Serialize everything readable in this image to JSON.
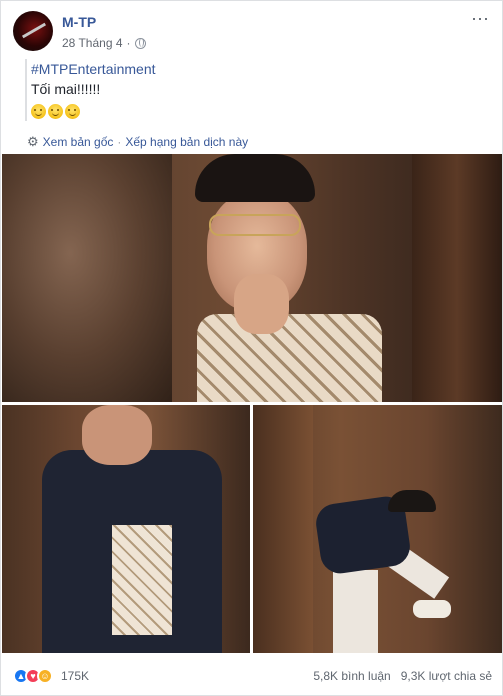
{
  "post": {
    "author": "M-TP",
    "date": "28 Tháng 4",
    "dot": "·",
    "hashtag": "#MTPEntertainment",
    "message": "Tối mai!!!!!!",
    "more_icon": "⋯",
    "translation": {
      "see_original": "Xem bản gốc",
      "separator": "·",
      "rate_translation": "Xếp hạng bản dịch này"
    }
  },
  "footer": {
    "reactions_count": "175K",
    "comments": "5,8K bình luận",
    "shares": "9,3K lượt chia sẻ"
  },
  "icons": [
    "globe-icon",
    "gear-icon",
    "like-icon",
    "love-icon",
    "haha-icon",
    "more-icon"
  ],
  "colors": {
    "link": "#385898",
    "like": "#1877f2",
    "love": "#f33e58",
    "haha": "#f7b125"
  }
}
